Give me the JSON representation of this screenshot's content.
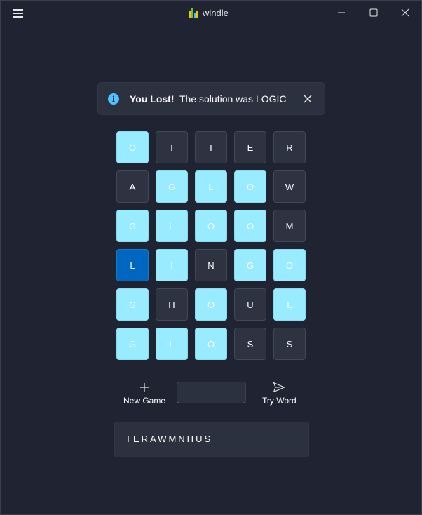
{
  "window": {
    "title": "windle",
    "icon": "bar-chart-app-icon"
  },
  "notification": {
    "icon": "info-icon",
    "icon_glyph": "i",
    "title": "You Lost!",
    "message": "The solution was LOGIC"
  },
  "board": {
    "rows": [
      [
        {
          "letter": "O",
          "state": "cyan"
        },
        {
          "letter": "T",
          "state": "grey"
        },
        {
          "letter": "T",
          "state": "grey"
        },
        {
          "letter": "E",
          "state": "grey"
        },
        {
          "letter": "R",
          "state": "grey"
        }
      ],
      [
        {
          "letter": "A",
          "state": "grey"
        },
        {
          "letter": "G",
          "state": "cyan"
        },
        {
          "letter": "L",
          "state": "cyan"
        },
        {
          "letter": "O",
          "state": "cyan"
        },
        {
          "letter": "W",
          "state": "grey"
        }
      ],
      [
        {
          "letter": "G",
          "state": "cyan"
        },
        {
          "letter": "L",
          "state": "cyan"
        },
        {
          "letter": "O",
          "state": "cyan"
        },
        {
          "letter": "O",
          "state": "cyan"
        },
        {
          "letter": "M",
          "state": "grey"
        }
      ],
      [
        {
          "letter": "L",
          "state": "blue"
        },
        {
          "letter": "I",
          "state": "cyan"
        },
        {
          "letter": "N",
          "state": "grey"
        },
        {
          "letter": "G",
          "state": "cyan"
        },
        {
          "letter": "O",
          "state": "cyan"
        }
      ],
      [
        {
          "letter": "G",
          "state": "cyan"
        },
        {
          "letter": "H",
          "state": "grey"
        },
        {
          "letter": "O",
          "state": "cyan"
        },
        {
          "letter": "U",
          "state": "grey"
        },
        {
          "letter": "L",
          "state": "cyan"
        }
      ],
      [
        {
          "letter": "G",
          "state": "cyan"
        },
        {
          "letter": "L",
          "state": "cyan"
        },
        {
          "letter": "O",
          "state": "cyan"
        },
        {
          "letter": "S",
          "state": "grey"
        },
        {
          "letter": "S",
          "state": "grey"
        }
      ]
    ]
  },
  "actions": {
    "new_game_label": "New Game",
    "try_word_label": "Try Word",
    "word_input_value": ""
  },
  "excluded_letters": "TERAWMNHUS",
  "colors": {
    "background": "#202432",
    "tile_grey": "#2e3342",
    "tile_cyan": "#99ebff",
    "tile_blue": "#0067c0",
    "info_accent": "#4cc2ff"
  }
}
